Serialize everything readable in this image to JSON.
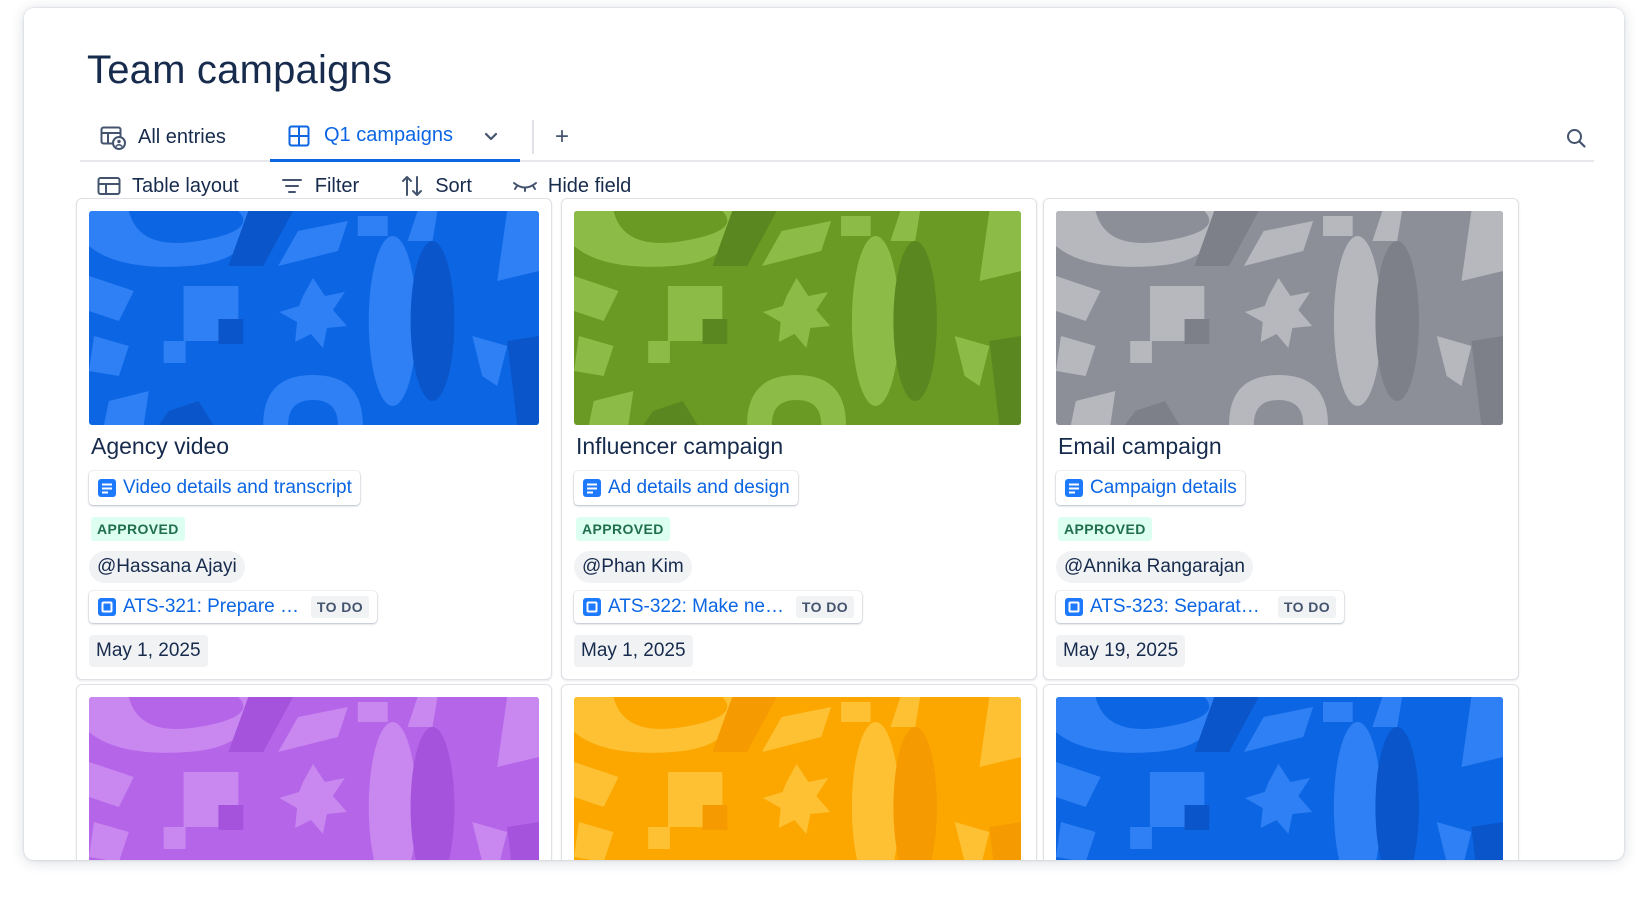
{
  "page": {
    "title": "Team campaigns"
  },
  "tabs": {
    "all_entries": "All entries",
    "active": "Q1 campaigns",
    "add": "+"
  },
  "toolbar": {
    "layout": "Table layout",
    "filter": "Filter",
    "sort": "Sort",
    "hide": "Hide field"
  },
  "colors": {
    "accent": "#0c66e4",
    "approved_bg": "#dcfff1",
    "approved_text": "#216e4e"
  },
  "cards": [
    {
      "title": "Agency video",
      "doc": "Video details and transcript",
      "status": "APPROVED",
      "owner": "Hassana Ajayi",
      "issue": "ATS-321: Prepare r…",
      "issue_status": "TO DO",
      "date": "May 1, 2025",
      "cover": {
        "bg": "#0c66e4",
        "shape": "#2f80f4",
        "shape_dark": "#0a55c9"
      }
    },
    {
      "title": "Influencer campaign",
      "doc": "Ad details and design",
      "status": "APPROVED",
      "owner": "Phan Kim",
      "issue": "ATS-322: Make nev…",
      "issue_status": "TO DO",
      "date": "May 1, 2025",
      "cover": {
        "bg": "#6a9a23",
        "shape": "#8cbb47",
        "shape_dark": "#5b8720"
      }
    },
    {
      "title": "Email campaign",
      "doc": "Campaign details",
      "status": "APPROVED",
      "owner": "Annika Rangarajan",
      "issue": "ATS-323: Separate…",
      "issue_status": "TO DO",
      "date": "May 19, 2025",
      "cover": {
        "bg": "#8c8f97",
        "shape": "#b6b8be",
        "shape_dark": "#7d8089"
      }
    },
    {
      "cover": {
        "bg": "#b565e8",
        "shape": "#c987f0",
        "shape_dark": "#a553dc"
      }
    },
    {
      "cover": {
        "bg": "#fca700",
        "shape": "#fdc133",
        "shape_dark": "#f59a00"
      }
    },
    {
      "cover": {
        "bg": "#0c66e4",
        "shape": "#2f80f4",
        "shape_dark": "#0a55c9"
      }
    }
  ]
}
